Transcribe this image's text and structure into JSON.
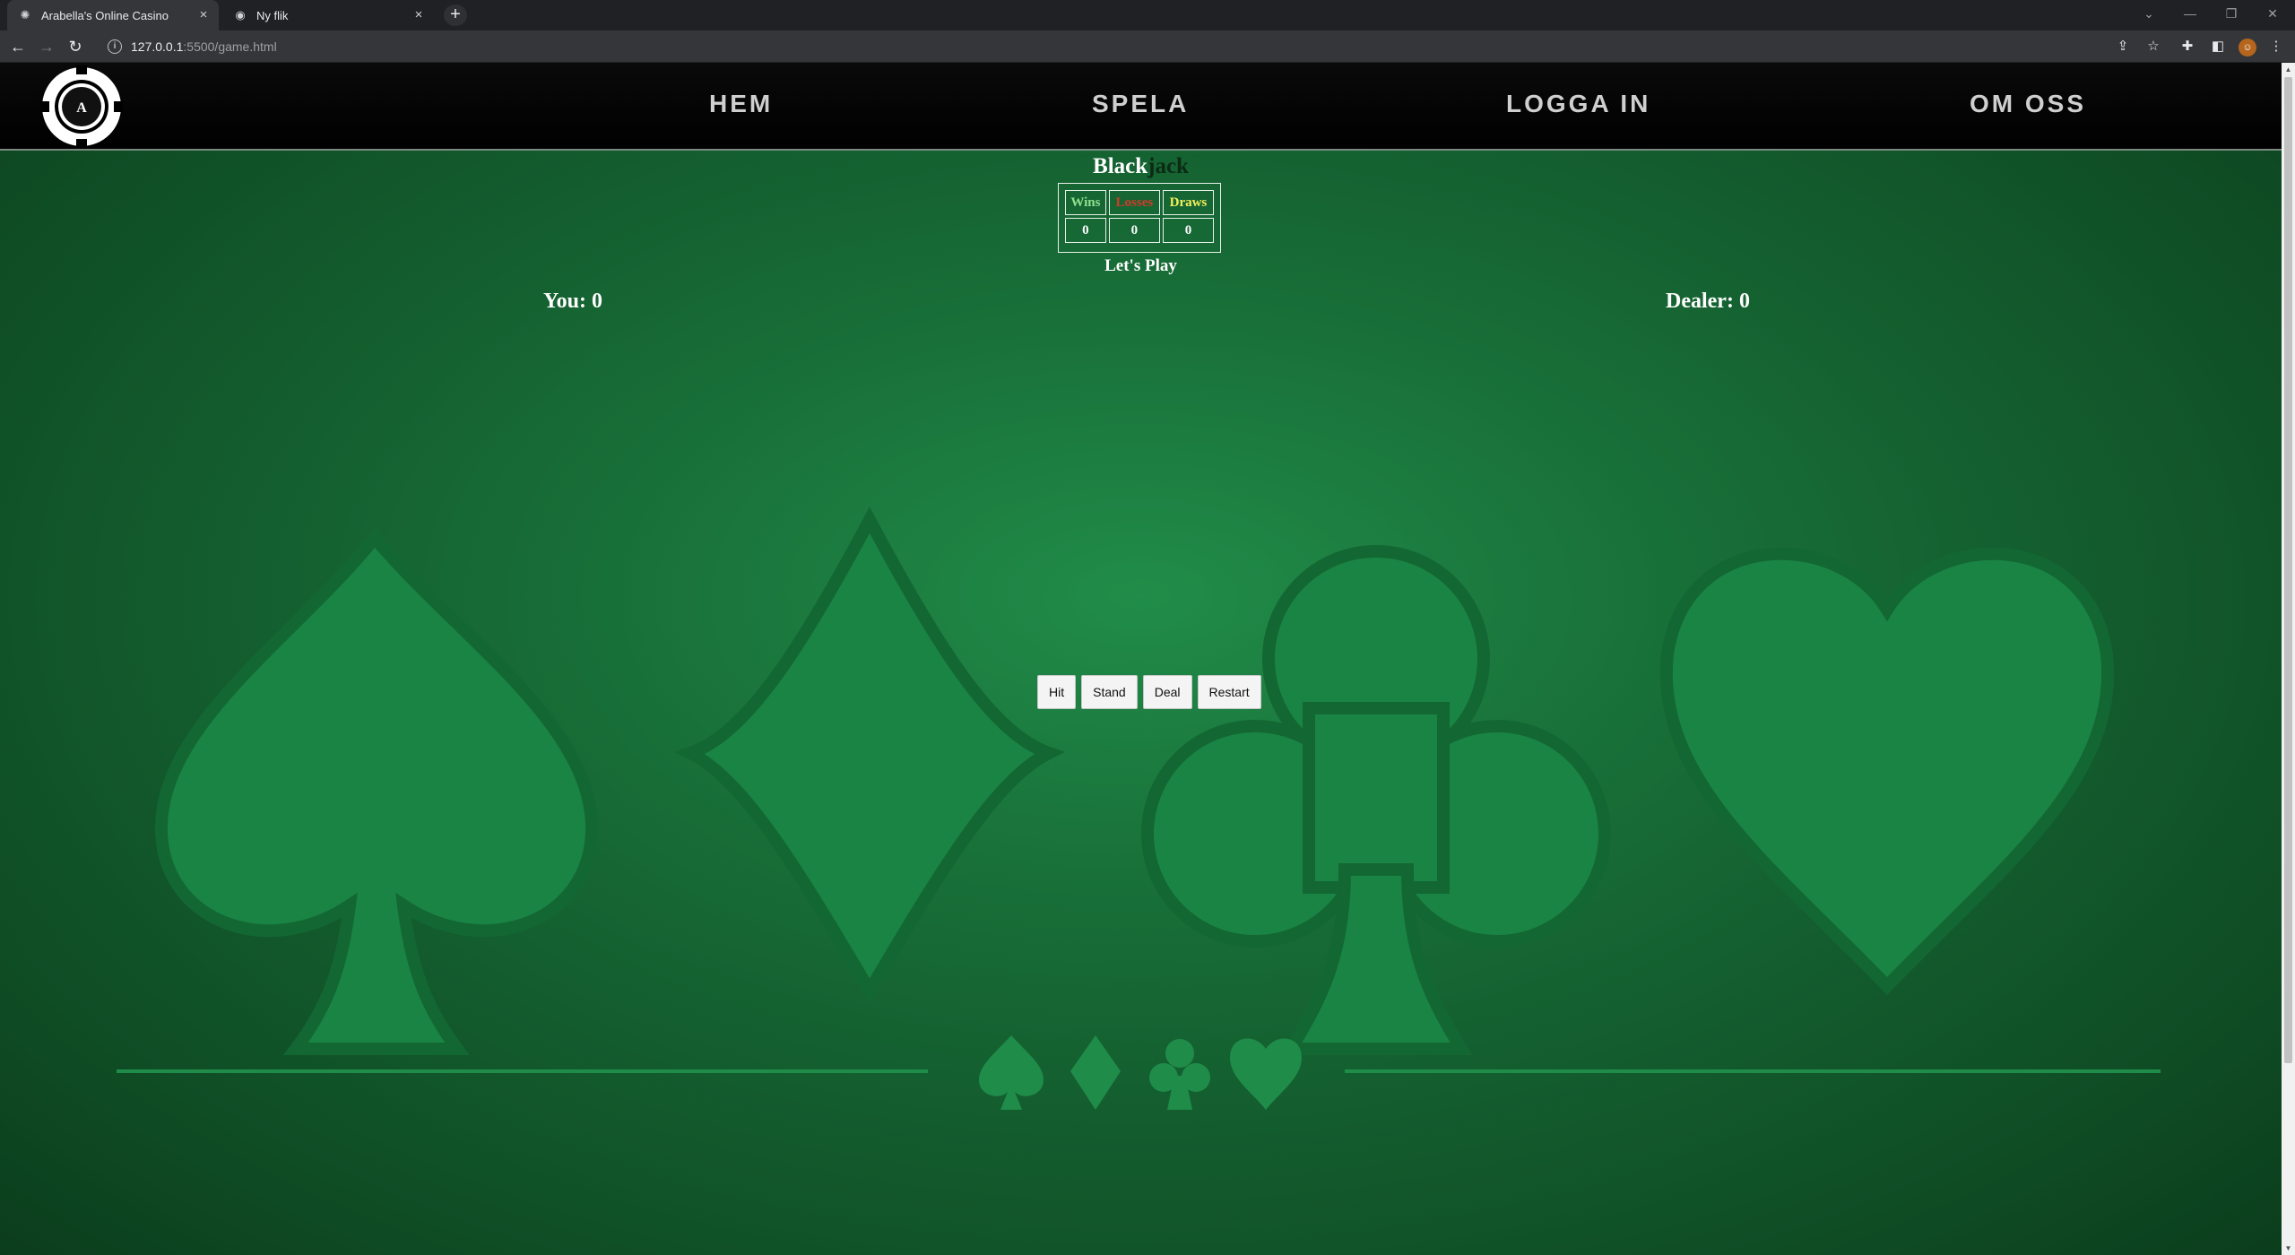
{
  "browser": {
    "tabs": [
      {
        "title": "Arabella's Online Casino",
        "active": true
      },
      {
        "title": "Ny flik",
        "active": false
      }
    ],
    "url_host": "127.0.0.1",
    "url_path": ":5500/game.html"
  },
  "site": {
    "logo_text": "ARABELLA'S CASINO",
    "nav": [
      "HEM",
      "SPELA",
      "LOGGA IN",
      "OM OSS"
    ]
  },
  "game": {
    "title_part1": "Black",
    "title_part2": "jack",
    "scoreboard": {
      "headers": [
        "Wins",
        "Losses",
        "Draws"
      ],
      "values": [
        "0",
        "0",
        "0"
      ]
    },
    "status": "Let's Play",
    "player_label": "You: 0",
    "dealer_label": "Dealer: 0",
    "buttons": [
      "Hit",
      "Stand",
      "Deal",
      "Restart"
    ]
  },
  "colors": {
    "felt": "#176b36",
    "wins": "#8fe08f",
    "losses": "#d23a2a",
    "draws": "#f4f05a"
  }
}
